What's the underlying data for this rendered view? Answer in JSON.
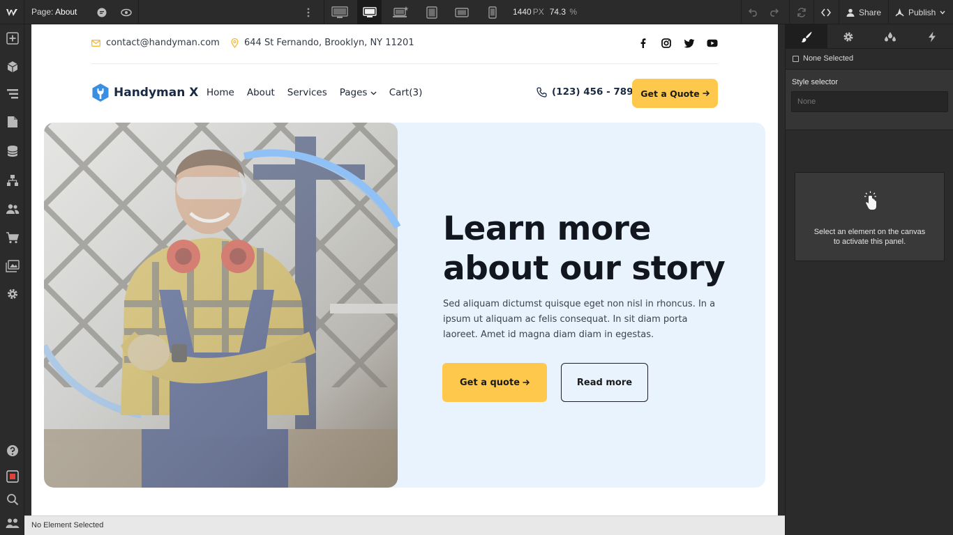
{
  "app": {
    "page_label": "Page:",
    "page_name": "About",
    "width_value": "1440",
    "width_unit": "PX",
    "zoom": "74.3",
    "zoom_unit": "%",
    "share_label": "Share",
    "publish_label": "Publish",
    "status_text": "No Element Selected"
  },
  "site": {
    "email": "contact@handyman.com",
    "address": "644 St Fernando, Brooklyn, NY 11201",
    "brand": "Handyman X",
    "menu": [
      "Home",
      "About",
      "Services",
      "Pages",
      "Cart(3)"
    ],
    "phone": "(123) 456 - 789",
    "quote_button": "Get a Quote",
    "headline_line1": "Learn more",
    "headline_line2": "about our story",
    "lede": "Sed aliquam dictumst quisque eget non nisl in rhoncus. In a ipsum ut aliquam ac felis consequat. In sit diam porta laoreet. Amet id magna diam diam in egestas.",
    "cta_primary": "Get a quote",
    "cta_secondary": "Read more"
  },
  "panel": {
    "none_selected": "None Selected",
    "style_selector_label": "Style selector",
    "style_selector_value": "None",
    "empty_line1": "Select an element on the canvas",
    "empty_line2": "to activate this panel."
  },
  "colors": {
    "accent_yellow": "#fdc84b",
    "hero_bg": "#e9f3fe",
    "arc_blue": "#8fc1f7",
    "brand_blue": "#3b8fe0",
    "editor_bg": "#2b2b2b"
  }
}
